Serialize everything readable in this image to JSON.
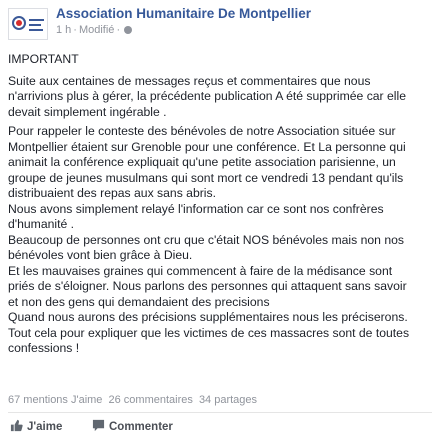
{
  "post": {
    "page_name": "Association Humanitaire De Montpellier",
    "time": "1 h",
    "edited": "Modifié",
    "paragraphs": [
      "IMPORTANT",
      "Suite aux centaines de messages reçus et commentaires que nous\nn'arrivions plus à gérer, la précédente publication A été supprimée car elle\ndevait simplement ingérable .",
      "Pour rappeler le conteste des bénévoles de notre Association située sur\nMontpellier étaient sur Grenoble pour une conférence. Et La personne qui\nanimait la conférence expliquait qu'une petite association parisienne, un\ngroupe de jeunes musulmans qui sont mort ce vendredi 13 pendant qu'ils\ndistribuaient des repas aux sans abris.\nNous avons simplement relayé l'information car ce sont nos confrères\nd'humanité .\nBeaucoup de personnes ont cru que c'était NOS bénévoles mais non nos\nbénévoles vont bien grâce à Dieu.\nEt les mauvaises graines qui commencent à faire de la médisance sont\npriés de s'éloigner. Nous parlons des personnes qui attaquent sans savoir\net non des gens qui demandaient des precisions\nQuand nous aurons des précisions supplémentaires nous les préciserons.\nTout cela pour expliquer que les victimes de ces massacres sont de toutes\nconfessions !"
    ],
    "likes": "67 mentions J'aime",
    "comments": "26 commentaires",
    "shares": "34 partages",
    "actions": {
      "like": "J'aime",
      "comment": "Commenter"
    },
    "colors": {
      "link": "#365899",
      "meta": "#90949c",
      "text": "#1d2129"
    }
  }
}
